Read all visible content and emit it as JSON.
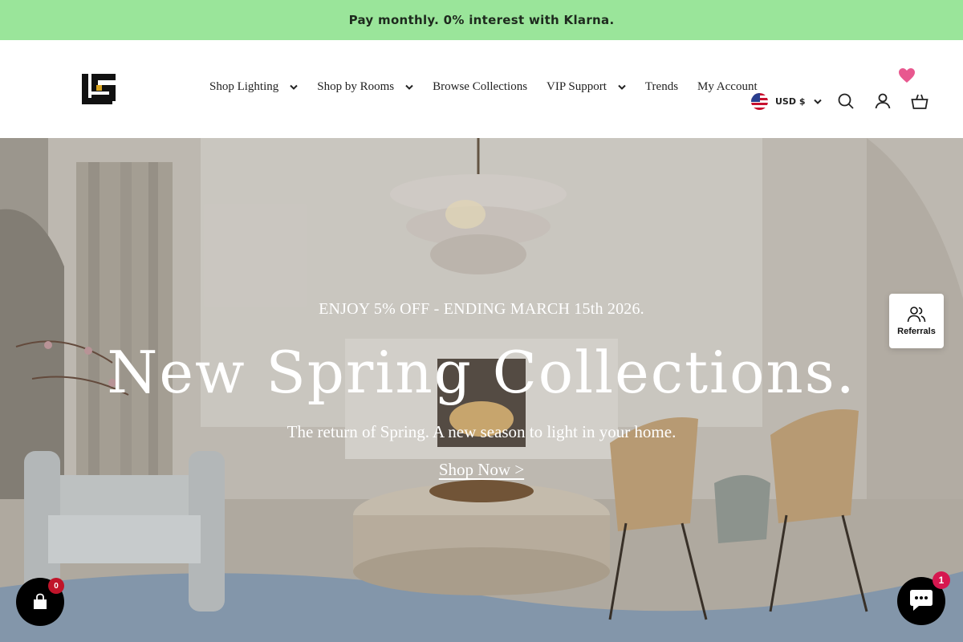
{
  "announcement": {
    "text": "Pay monthly. 0% interest with Klarna."
  },
  "header": {
    "nav": [
      {
        "label": "Shop Lighting",
        "has_dropdown": true
      },
      {
        "label": "Shop by Rooms",
        "has_dropdown": true
      },
      {
        "label": "Browse Collections",
        "has_dropdown": false
      },
      {
        "label": "VIP Support",
        "has_dropdown": true
      },
      {
        "label": "Trends",
        "has_dropdown": false
      },
      {
        "label": "My Account",
        "has_dropdown": false
      }
    ],
    "currency": {
      "label": "USD $",
      "flag": "us-flag-icon"
    },
    "icons": [
      "heart-icon",
      "search-icon",
      "account-icon",
      "cart-icon"
    ]
  },
  "hero": {
    "eyebrow": "ENJOY 5% OFF - ENDING MARCH 15th 2026.",
    "headline": "New Spring Collections.",
    "subline": "The return of Spring. A new season to light in your home.",
    "cta": "Shop Now >"
  },
  "widgets": {
    "referrals_label": "Referrals",
    "cart_count": "0",
    "chat_unread": "1"
  },
  "colors": {
    "announcement_bg": "#9ae59a",
    "heart": "#e8588f",
    "badge_red": "#c0142a",
    "chat_badge": "#d6174f"
  }
}
